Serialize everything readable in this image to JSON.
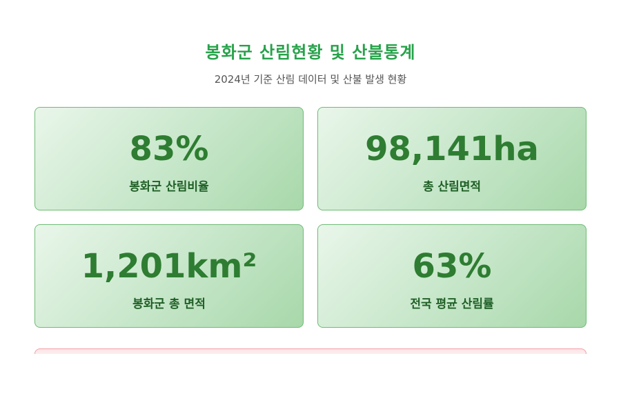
{
  "header": {
    "title": "봉화군 산림현황 및 산불통계",
    "subtitle": "2024년 기준 산림 데이터 및 산불 발생 현황"
  },
  "stats": [
    {
      "value": "83%",
      "label": "봉화군 산림비율"
    },
    {
      "value": "98,141ha",
      "label": "총 산림면적"
    },
    {
      "value": "1,201km²",
      "label": "봉화군 총 면적"
    },
    {
      "value": "63%",
      "label": "전국 평균 산림률"
    }
  ],
  "colors": {
    "title": "#27a24a",
    "stat_value": "#2e7d32",
    "card_border": "#6dbb74",
    "alert_border": "#f2a0a6"
  }
}
